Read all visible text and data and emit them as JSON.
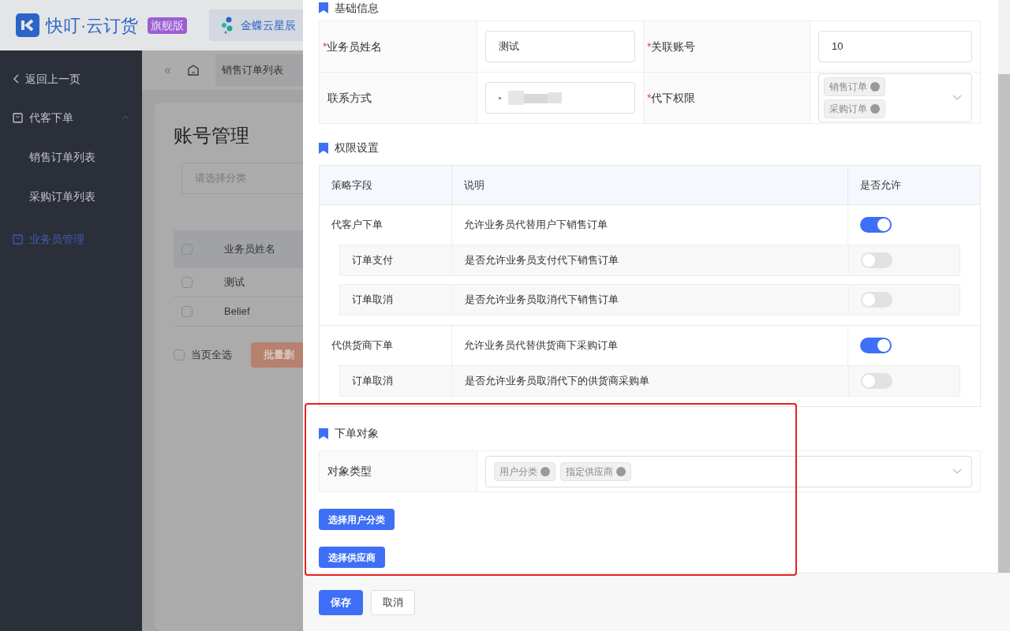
{
  "header": {
    "brand": "快叮·云订货",
    "edition": "旗舰版",
    "app": {
      "label": "金蝶云星辰",
      "selected": true
    }
  },
  "sidebar": {
    "back": "返回上一页",
    "items": [
      {
        "label": "代客下单",
        "selected": false,
        "expanded": true,
        "children": [
          {
            "label": "销售订单列表",
            "selected": false
          },
          {
            "label": "采购订单列表",
            "selected": false
          }
        ]
      },
      {
        "label": "业务员管理",
        "selected": true
      }
    ]
  },
  "toolbar": {
    "collapse": "«"
  },
  "tabs": [
    {
      "label": "销售订单列表"
    }
  ],
  "page": {
    "title": "账号管理",
    "filter_placeholder": "请选择分类",
    "column": "业务员姓名",
    "header_checked": false,
    "rows": [
      {
        "name": "测试",
        "checked": false
      },
      {
        "name": "Belief",
        "checked": false
      }
    ],
    "select_all": {
      "label": "当页全选",
      "checked": false
    },
    "batch_button": "批量删"
  },
  "drawer": {
    "basic": {
      "title": "基础信息",
      "rows": [
        [
          {
            "marker": "*",
            "label": "业务员姓名",
            "kind": "text",
            "value": "测试"
          },
          {
            "marker": "*",
            "label": "关联账号",
            "kind": "text",
            "value": "10"
          }
        ],
        [
          {
            "label": "联系方式",
            "kind": "redacted"
          },
          {
            "marker": "*",
            "label": "代下权限",
            "kind": "tags",
            "tags": [
              "销售订单",
              "采购订单"
            ]
          }
        ]
      ]
    },
    "permissions": {
      "title": "权限设置",
      "columns": [
        "策略字段",
        "说明",
        "是否允许"
      ],
      "groups": [
        {
          "name": "代客户下单",
          "desc": "允许业务员代替用户下销售订单",
          "on": true,
          "children": [
            {
              "name": "订单支付",
              "desc": "是否允许业务员支付代下销售订单",
              "on": false
            },
            {
              "name": "订单取消",
              "desc": "是否允许业务员取消代下销售订单",
              "on": false
            }
          ]
        },
        {
          "name": "代供货商下单",
          "desc": "允许业务员代替供货商下采购订单",
          "on": true,
          "children": [
            {
              "name": "订单取消",
              "desc": "是否允许业务员取消代下的供货商采购单",
              "on": false
            }
          ]
        }
      ]
    },
    "target": {
      "title": "下单对象",
      "label": "对象类型",
      "tags": [
        "用户分类",
        "指定供应商"
      ],
      "buttons": [
        "选择用户分类",
        "选择供应商"
      ]
    },
    "footer": {
      "save": "保存",
      "cancel": "取消"
    }
  }
}
